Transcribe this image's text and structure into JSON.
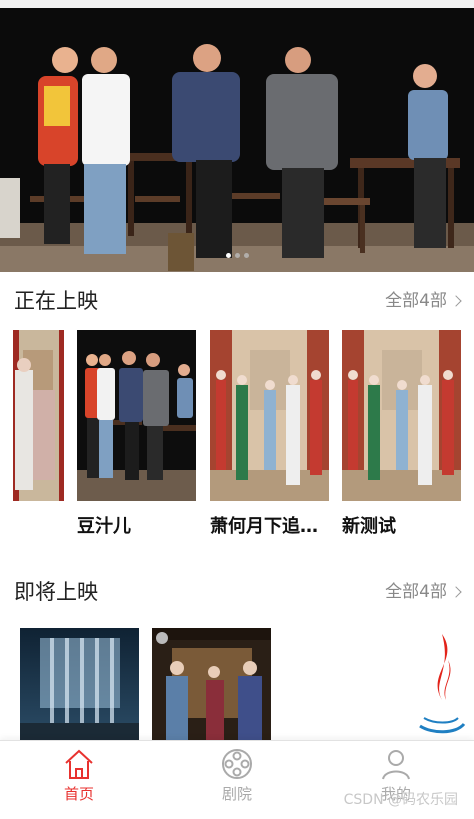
{
  "banner": {
    "slide_count": 3,
    "active_slide": 1
  },
  "now_showing": {
    "title": "正在上映",
    "more_label": "全部4部",
    "items": [
      {
        "name": ""
      },
      {
        "name": "豆汁儿"
      },
      {
        "name": "萧何月下追…"
      },
      {
        "name": "新测试"
      }
    ]
  },
  "coming_soon": {
    "title": "即将上映",
    "more_label": "全部4部"
  },
  "tabbar": {
    "items": [
      {
        "label": "首页",
        "icon": "home-icon",
        "active": true
      },
      {
        "label": "剧院",
        "icon": "theater-reel-icon",
        "active": false
      },
      {
        "label": "我的",
        "icon": "user-icon",
        "active": false
      }
    ]
  },
  "watermark": "CSDN @码农乐园",
  "colors": {
    "accent": "#e8322f",
    "text": "#222222",
    "muted": "#888888"
  }
}
